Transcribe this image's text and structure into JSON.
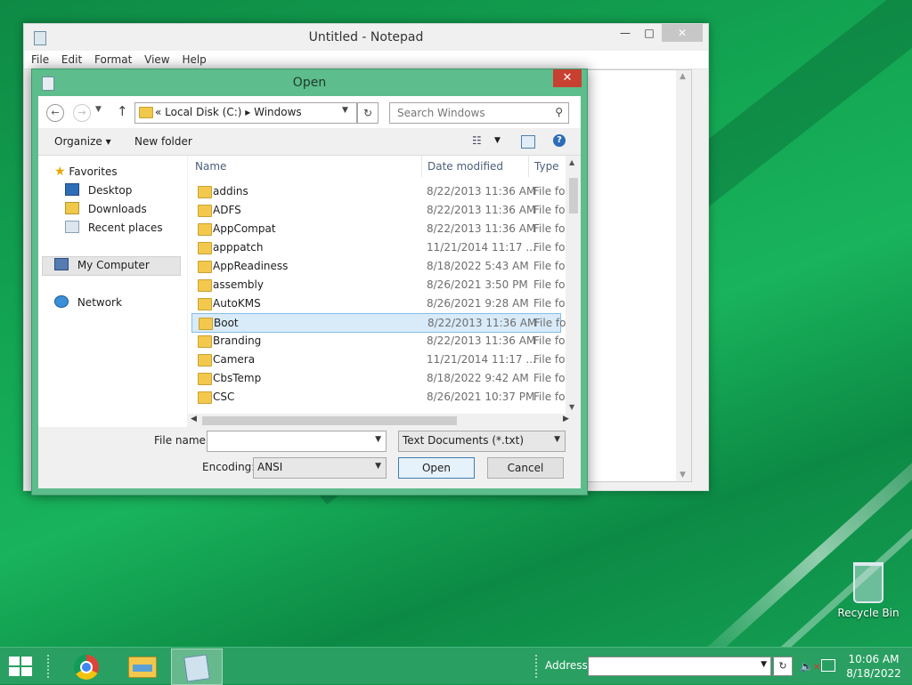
{
  "desktop": {
    "icons": [
      {
        "label": "Recycle Bin"
      }
    ]
  },
  "notepad": {
    "title": "Untitled - Notepad",
    "controls": {
      "minimize": "—",
      "maximize": "□",
      "close": "✕"
    },
    "menu": [
      "File",
      "Edit",
      "Format",
      "View",
      "Help"
    ]
  },
  "dialog": {
    "title": "Open",
    "close": "✕",
    "breadcrumb": "«  Local Disk (C:)  ▸  Windows",
    "search_placeholder": "Search Windows",
    "toolbar": {
      "organize": "Organize ▾",
      "new_folder": "New folder"
    },
    "nav": {
      "favorites": "Favorites",
      "desktop": "Desktop",
      "downloads": "Downloads",
      "recent": "Recent places",
      "computer": "My Computer",
      "network": "Network"
    },
    "columns": {
      "name": "Name",
      "date": "Date modified",
      "type": "Type"
    },
    "files": [
      {
        "name": "addins",
        "date": "8/22/2013 11:36 AM",
        "type": "File fol"
      },
      {
        "name": "ADFS",
        "date": "8/22/2013 11:36 AM",
        "type": "File fol"
      },
      {
        "name": "AppCompat",
        "date": "8/22/2013 11:36 AM",
        "type": "File fol"
      },
      {
        "name": "apppatch",
        "date": "11/21/2014 11:17 ...",
        "type": "File fol"
      },
      {
        "name": "AppReadiness",
        "date": "8/18/2022 5:43 AM",
        "type": "File fol"
      },
      {
        "name": "assembly",
        "date": "8/26/2021 3:50 PM",
        "type": "File fol"
      },
      {
        "name": "AutoKMS",
        "date": "8/26/2021 9:28 AM",
        "type": "File fol"
      },
      {
        "name": "Boot",
        "date": "8/22/2013 11:36 AM",
        "type": "File fol"
      },
      {
        "name": "Branding",
        "date": "8/22/2013 11:36 AM",
        "type": "File fol"
      },
      {
        "name": "Camera",
        "date": "11/21/2014 11:17 ...",
        "type": "File fol"
      },
      {
        "name": "CbsTemp",
        "date": "8/18/2022 9:42 AM",
        "type": "File fol"
      },
      {
        "name": "CSC",
        "date": "8/26/2021 10:37 PM",
        "type": "File fol"
      }
    ],
    "selected_file": "Boot",
    "filename_label": "File name:",
    "filename_value": "",
    "filetype_value": "Text Documents (*.txt)",
    "encoding_label": "Encoding:",
    "encoding_value": "ANSI",
    "open_button": "Open",
    "cancel_button": "Cancel"
  },
  "taskbar": {
    "address_label": "Address",
    "address_value": "",
    "time": "10:06 AM",
    "date": "8/18/2022"
  }
}
